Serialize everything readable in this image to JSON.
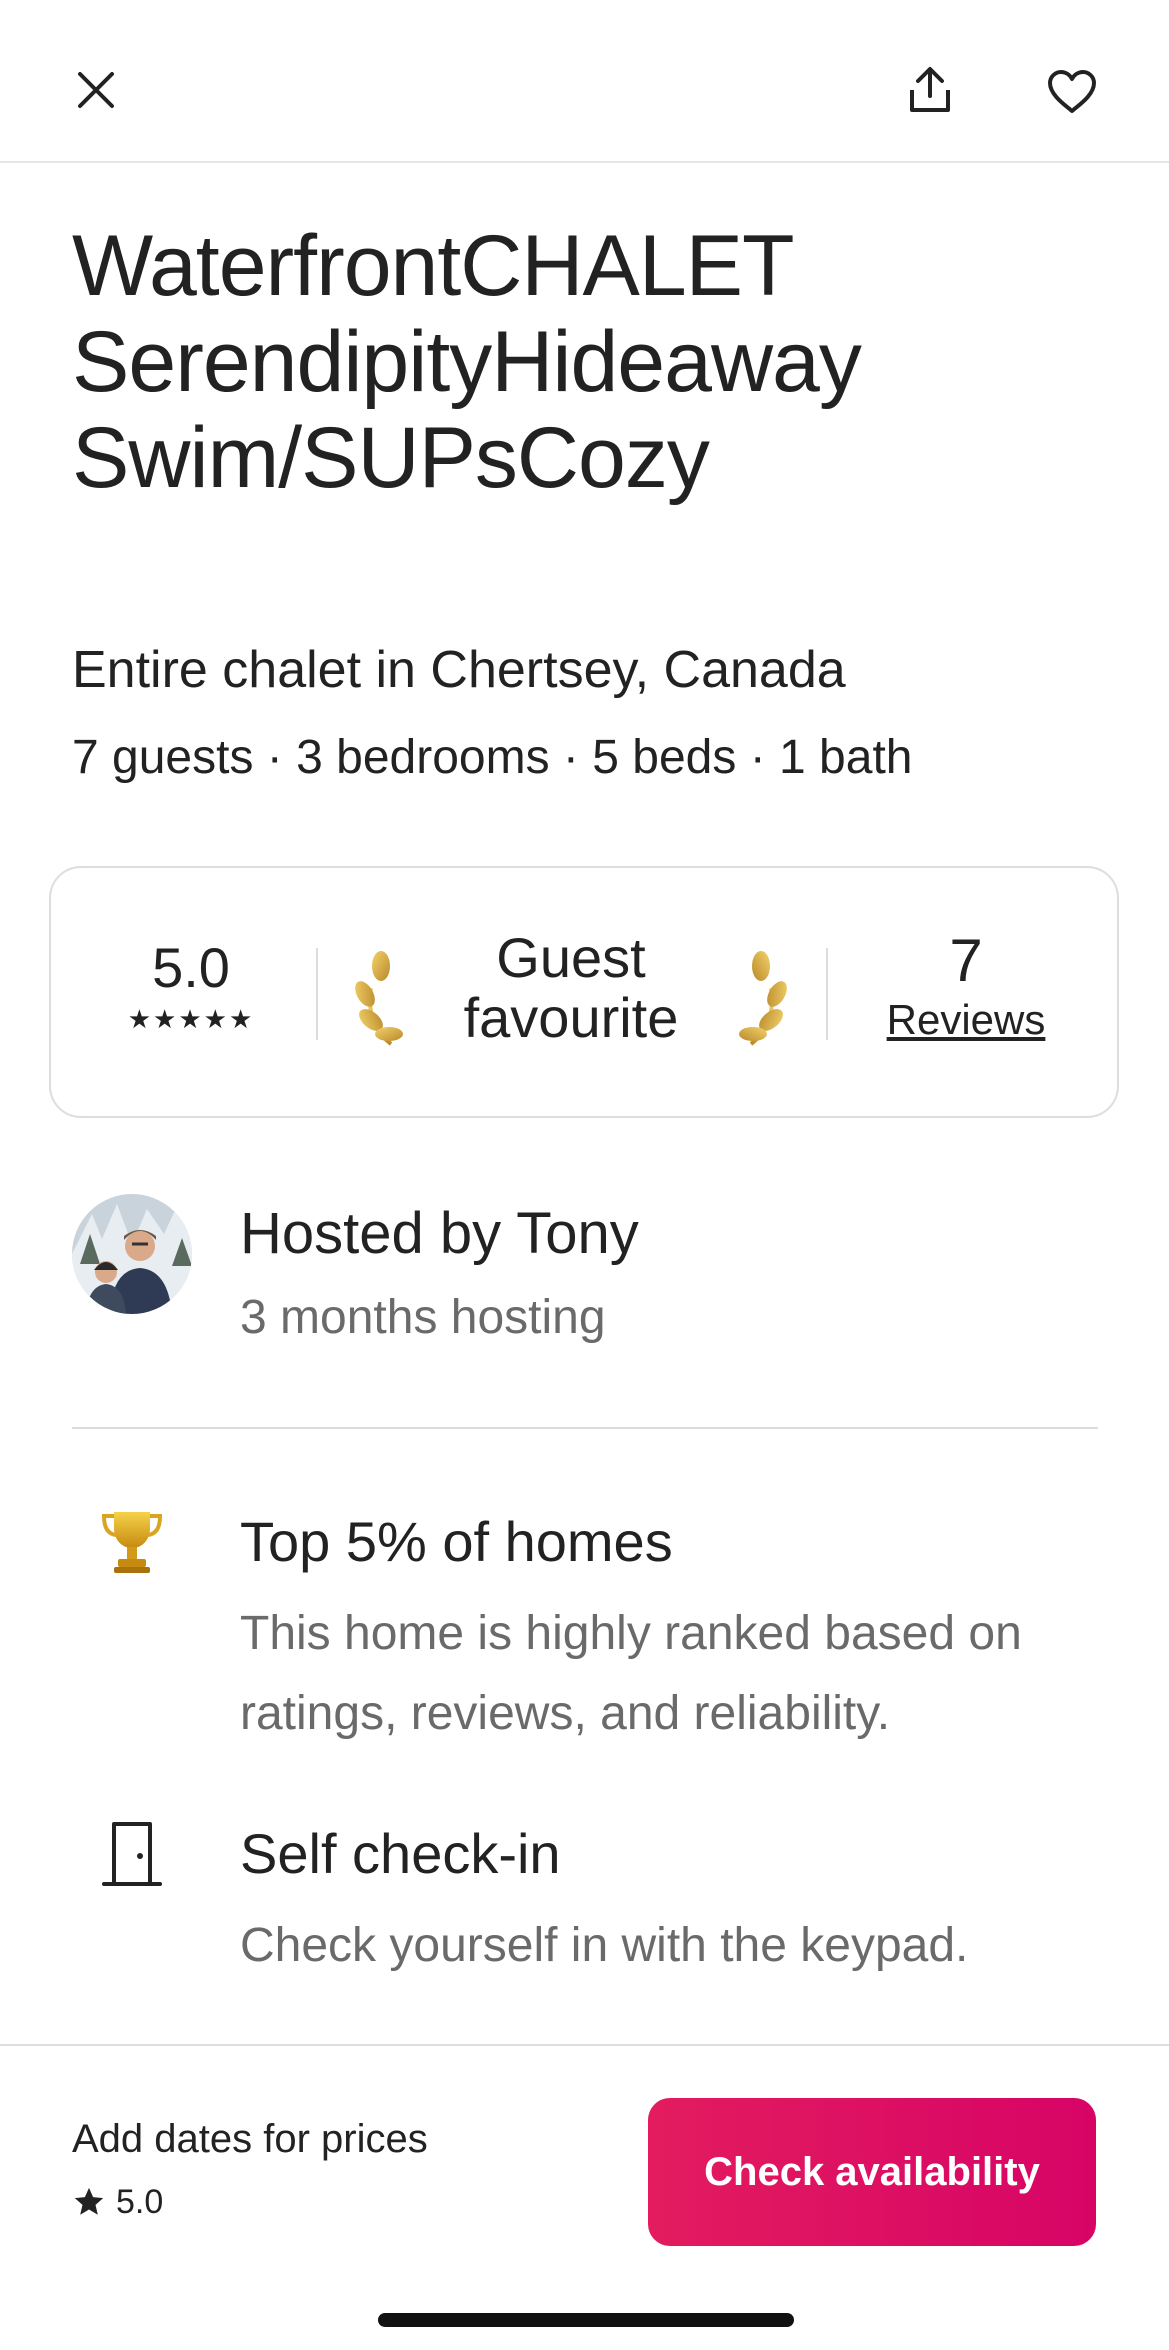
{
  "listing": {
    "title": "WaterfrontCHALET SerendipityHideaway Swim/SUPsCozy",
    "subtitle": "Entire chalet in Chertsey, Canada",
    "details": "7 guests · 3 bedrooms · 5 beds · 1 bath"
  },
  "rating_card": {
    "score": "5.0",
    "stars": "★★★★★",
    "badge_line1": "Guest",
    "badge_line2": "favourite",
    "reviews_count": "7",
    "reviews_label": "Reviews"
  },
  "host": {
    "name": "Hosted by Tony",
    "tenure": "3 months hosting"
  },
  "features": [
    {
      "icon": "trophy-icon",
      "title": "Top 5% of homes",
      "description": "This home is highly ranked based on ratings, reviews, and reliability."
    },
    {
      "icon": "door-icon",
      "title": "Self check-in",
      "description": "Check yourself in with the keypad."
    }
  ],
  "bottom_bar": {
    "price_text": "Add dates for prices",
    "rating": "5.0",
    "cta_label": "Check availability"
  },
  "colors": {
    "accent": "#e31c5f",
    "text": "#222222",
    "muted": "#6a6a6a",
    "border": "#dddddd"
  }
}
